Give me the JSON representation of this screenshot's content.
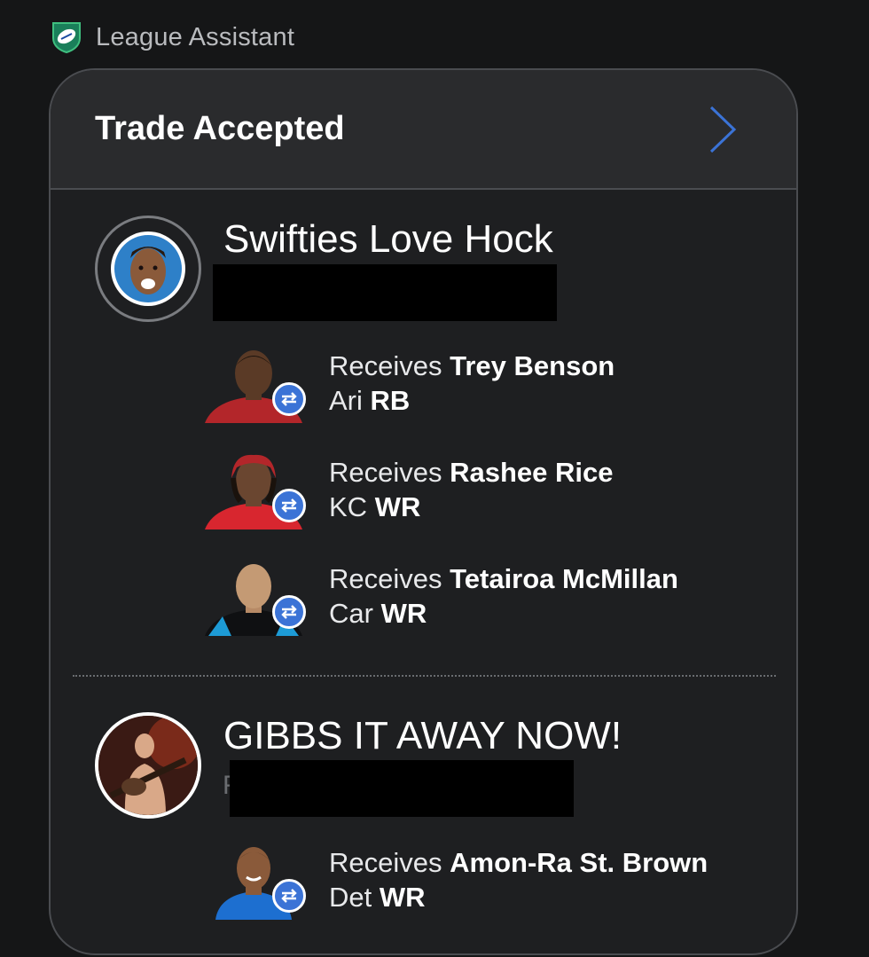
{
  "app": {
    "name": "League Assistant",
    "logo_icon": "football-shield-icon"
  },
  "card": {
    "title": "Trade Accepted",
    "open_icon": "chevron-right-icon",
    "accent": "#3b73d6"
  },
  "teams": [
    {
      "name": "Swifties Love Hock",
      "redacted_peek": "",
      "players": [
        {
          "prefix": "Receives",
          "name": "Trey Benson",
          "team": "Ari",
          "position": "RB",
          "jersey": "#b3262a"
        },
        {
          "prefix": "Receives",
          "name": "Rashee Rice",
          "team": "KC",
          "position": "WR",
          "jersey": "#d8262f"
        },
        {
          "prefix": "Receives",
          "name": "Tetairoa McMillan",
          "team": "Car",
          "position": "WR",
          "jersey": "#0f1012"
        }
      ]
    },
    {
      "name": "GIBBS IT AWAY NOW!",
      "redacted_peek": "F",
      "players": [
        {
          "prefix": "Receives",
          "name": "Amon-Ra St. Brown",
          "team": "Det",
          "position": "WR",
          "jersey": "#1d6fd0"
        }
      ]
    }
  ]
}
